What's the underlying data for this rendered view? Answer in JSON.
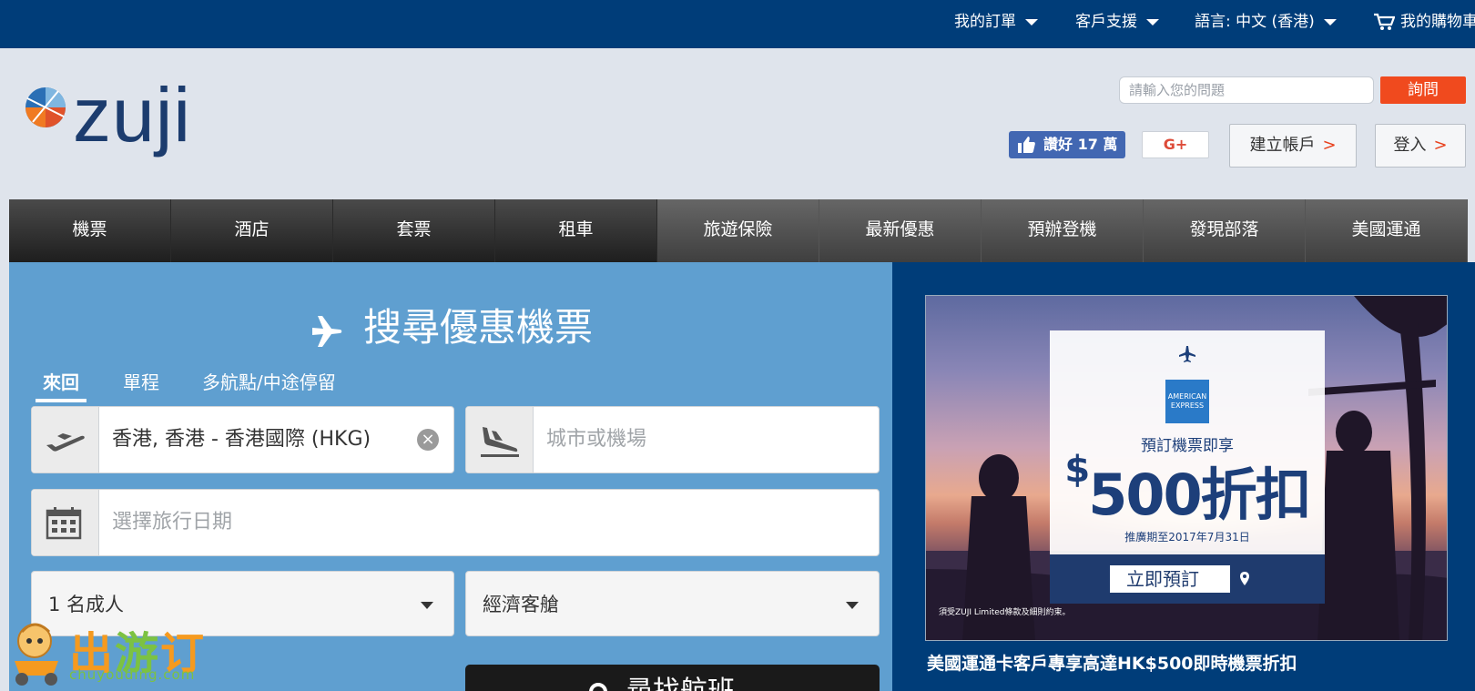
{
  "topbar": {
    "my_orders": "我的訂單",
    "support": "客戶支援",
    "language": "語言: 中文 (香港)",
    "cart": "我的購物車"
  },
  "header": {
    "logo_text": "zuji",
    "question_placeholder": "請輸入您的問題",
    "ask_label": "詢問",
    "fb_like_label": "讚好 17 萬",
    "gplus_label": "G+",
    "create_account": "建立帳戶",
    "login": "登入",
    "arrow": ">"
  },
  "nav": {
    "items": [
      "機票",
      "酒店",
      "套票",
      "租車",
      "旅遊保險",
      "最新優惠",
      "預辦登機",
      "發現部落",
      "美國運通"
    ]
  },
  "search": {
    "title": "搜尋優惠機票",
    "tabs": [
      "來回",
      "單程",
      "多航點/中途停留"
    ],
    "origin_value": "香港, 香港 - 香港國際 (HKG)",
    "destination_placeholder": "城市或機場",
    "date_placeholder": "選擇旅行日期",
    "passengers_value": "1 名成人",
    "cabin_value": "經濟客艙",
    "search_button": "尋找航班"
  },
  "promo": {
    "line1": "預訂機票即享",
    "dollar": "$",
    "amount": "500折扣",
    "period": "推廣期至2017年7月31日",
    "book_now": "立即預訂",
    "fine_print": "須受ZUJI Limited條款及細則約束。",
    "caption": "美國運通卡客戶專享高達HK$500即時機票折扣"
  },
  "watermark": {
    "text_a": "出",
    "text_b": "游",
    "text_c": "订",
    "sub": "chuyouding.com"
  },
  "colors": {
    "topbar": "#003d79",
    "accent": "#f04a1e",
    "panel": "#5f9fd0"
  }
}
